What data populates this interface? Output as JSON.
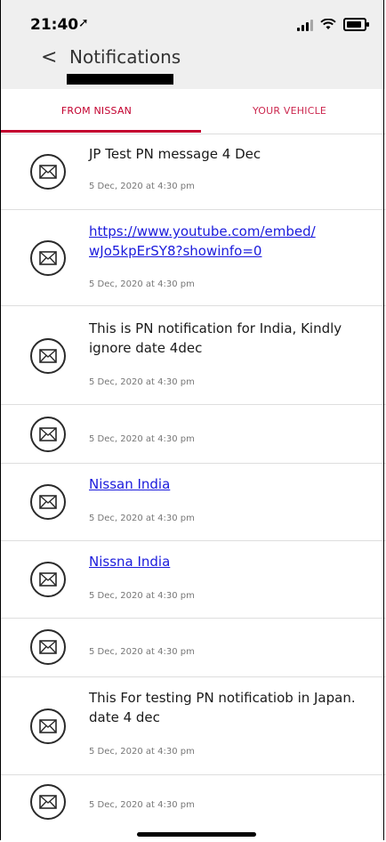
{
  "status_bar": {
    "time": "21:40",
    "location_glyph": "➚"
  },
  "nav": {
    "back_glyph": "<",
    "title": "Notifications"
  },
  "tabs": [
    {
      "label": "FROM NISSAN",
      "active": true
    },
    {
      "label": "YOUR VEHICLE",
      "active": false
    }
  ],
  "notifications": [
    {
      "message": "JP Test PN message 4 Dec",
      "is_link": false,
      "date": "5 Dec, 2020 at 4:30 pm"
    },
    {
      "message": "https://www.youtube.com/embed/wJo5kpErSY8?showinfo=0",
      "line1": "https://www.youtube.com/embed/",
      "line2": "wJo5kpErSY8?showinfo=0",
      "is_link": true,
      "date": "5 Dec, 2020 at 4:30 pm"
    },
    {
      "message": "This is PN notification for India, Kindly ignore date 4dec",
      "line1": "This is PN notification for India, Kindly",
      "line2": "ignore date 4dec",
      "is_link": false,
      "date": "5 Dec, 2020 at 4:30 pm"
    },
    {
      "message": "",
      "is_link": false,
      "date": "5 Dec, 2020 at 4:30 pm"
    },
    {
      "message": "Nissan India",
      "is_link": true,
      "date": "5 Dec, 2020 at 4:30 pm"
    },
    {
      "message": "Nissna India",
      "is_link": true,
      "date": "5 Dec, 2020 at 4:30 pm"
    },
    {
      "message": "",
      "is_link": false,
      "date": "5 Dec, 2020 at 4:30 pm"
    },
    {
      "message": "This For testing PN notificatiob in Japan. date 4 dec",
      "line1": "This For testing PN notificatiob in Japan.",
      "line2": "date 4 dec",
      "is_link": false,
      "date": "5 Dec, 2020 at 4:30 pm"
    },
    {
      "message": "",
      "is_link": false,
      "date": "5 Dec, 2020 at 4:30 pm"
    }
  ],
  "colors": {
    "accent": "#c3002f",
    "link": "#1a1adc",
    "header_bg": "#efefef"
  },
  "icons": {
    "message": "envelope-icon",
    "back": "chevron-left-icon"
  }
}
